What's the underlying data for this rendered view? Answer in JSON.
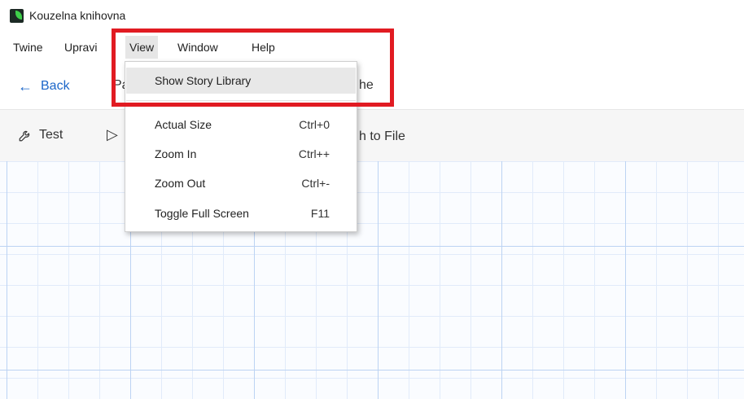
{
  "window": {
    "title": "Kouzelna knihovna"
  },
  "menubar": {
    "items": [
      {
        "label": "Twine"
      },
      {
        "label": "Upravi"
      },
      {
        "label": "View"
      },
      {
        "label": "Window"
      },
      {
        "label": "Help"
      }
    ]
  },
  "toolbar": {
    "back_label": "Back",
    "partial_left": "Pa",
    "partial_right": "he"
  },
  "toolbar2": {
    "test_label": "Test",
    "partial_arrow": "▷",
    "partial_publish": "h to File"
  },
  "view_menu": {
    "items": [
      {
        "label": "Show Story Library",
        "shortcut": ""
      },
      {
        "label": "Actual Size",
        "shortcut": "Ctrl+0"
      },
      {
        "label": "Zoom In",
        "shortcut": "Ctrl++"
      },
      {
        "label": "Zoom Out",
        "shortcut": "Ctrl+-"
      },
      {
        "label": "Toggle Full Screen",
        "shortcut": "F11"
      }
    ]
  },
  "icons": {
    "back": "arrow-left-icon",
    "test": "wrench-icon",
    "play": "play-icon"
  },
  "colors": {
    "link_blue": "#1b66c9",
    "highlight_red": "#e11b22",
    "grid_major": "#bcd3f3",
    "grid_minor": "#e1ebfa"
  }
}
